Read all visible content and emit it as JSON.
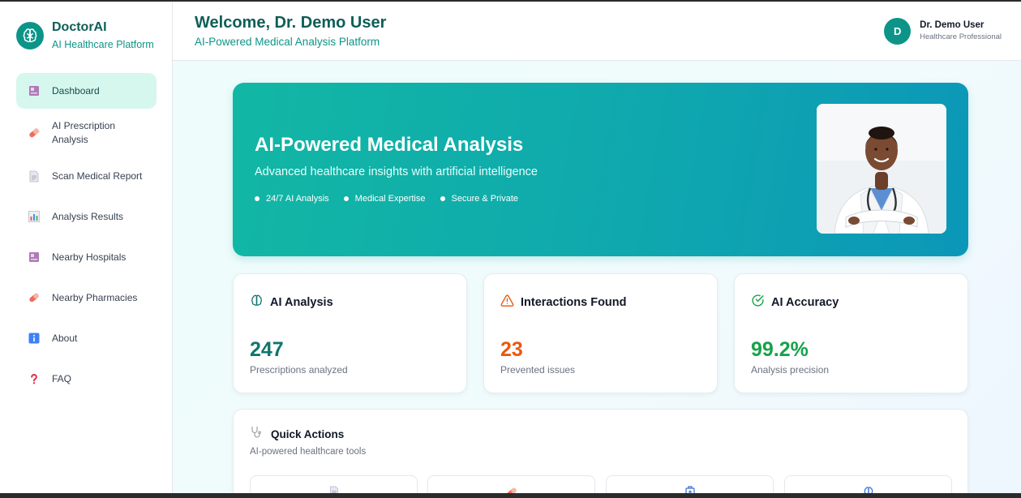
{
  "brand": {
    "name": "DoctorAI",
    "subtitle": "AI Healthcare Platform"
  },
  "sidebar": {
    "items": [
      {
        "label": "Dashboard",
        "icon": "dashboard-icon",
        "active": true
      },
      {
        "label": "AI Prescription Analysis",
        "icon": "pill-icon",
        "active": false
      },
      {
        "label": "Scan Medical Report",
        "icon": "document-icon",
        "active": false
      },
      {
        "label": "Analysis Results",
        "icon": "bar-chart-icon",
        "active": false
      },
      {
        "label": "Nearby Hospitals",
        "icon": "hospital-icon",
        "active": false
      },
      {
        "label": "Nearby Pharmacies",
        "icon": "pill-icon",
        "active": false
      },
      {
        "label": "About",
        "icon": "info-icon",
        "active": false
      },
      {
        "label": "FAQ",
        "icon": "question-icon",
        "active": false
      }
    ]
  },
  "header": {
    "title": "Welcome, Dr. Demo User",
    "subtitle": "AI-Powered Medical Analysis Platform",
    "user": {
      "initial": "D",
      "name": "Dr. Demo User",
      "role": "Healthcare Professional"
    }
  },
  "hero": {
    "title": "AI-Powered Medical Analysis",
    "subtitle": "Advanced healthcare insights with artificial intelligence",
    "features": [
      "24/7 AI Analysis",
      "Medical Expertise",
      "Secure & Private"
    ],
    "image": "doctor-photo"
  },
  "stats": [
    {
      "title": "AI Analysis",
      "value": "247",
      "label": "Prescriptions analyzed",
      "icon": "brain-icon",
      "color": "#0f766e"
    },
    {
      "title": "Interactions Found",
      "value": "23",
      "label": "Prevented issues",
      "icon": "warning-icon",
      "color": "#ea580c"
    },
    {
      "title": "AI Accuracy",
      "value": "99.2%",
      "label": "Analysis precision",
      "icon": "check-circle-icon",
      "color": "#16a34a"
    }
  ],
  "quick_actions": {
    "title": "Quick Actions",
    "subtitle": "AI-powered healthcare tools",
    "icon": "stethoscope-icon",
    "tiles": [
      {
        "icon": "document-icon"
      },
      {
        "icon": "pill-icon"
      },
      {
        "icon": "hospital-icon"
      },
      {
        "icon": "brain-icon"
      }
    ]
  },
  "colors": {
    "primary": "#0d9488",
    "primary_dark": "#0f5e58",
    "active_bg": "#d6f7ee"
  }
}
